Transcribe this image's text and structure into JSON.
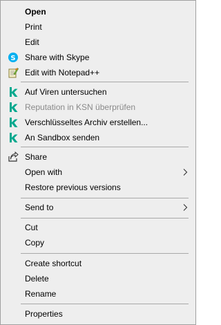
{
  "context_menu": {
    "items": [
      {
        "label": "Open",
        "icon": null
      },
      {
        "label": "Print",
        "icon": null
      },
      {
        "label": "Edit",
        "icon": null
      },
      {
        "label": "Share with Skype",
        "icon": "skype-icon"
      },
      {
        "label": "Edit with Notepad++",
        "icon": "notepad-plus-plus-icon"
      },
      {
        "label": "Auf Viren untersuchen",
        "icon": "kaspersky-icon"
      },
      {
        "label": "Reputation in KSN überprüfen",
        "icon": "kaspersky-icon",
        "disabled": true
      },
      {
        "label": "Verschlüsseltes Archiv erstellen...",
        "icon": "kaspersky-icon"
      },
      {
        "label": "An Sandbox senden",
        "icon": "kaspersky-icon"
      },
      {
        "label": "Share",
        "icon": "share-icon"
      },
      {
        "label": "Open with",
        "icon": null,
        "submenu": true
      },
      {
        "label": "Restore previous versions",
        "icon": null
      },
      {
        "label": "Send to",
        "icon": null,
        "submenu": true
      },
      {
        "label": "Cut",
        "icon": null
      },
      {
        "label": "Copy",
        "icon": null
      },
      {
        "label": "Create shortcut",
        "icon": null
      },
      {
        "label": "Delete",
        "icon": null
      },
      {
        "label": "Rename",
        "icon": null
      },
      {
        "label": "Properties",
        "icon": null
      }
    ]
  },
  "colors": {
    "menu_background": "#eeeeee",
    "menu_border": "#a0a0a0",
    "separator": "#a8a8a8",
    "disabled_text": "#8a8a8a",
    "skype_blue": "#00aff0",
    "kaspersky_green": "#00a88e"
  }
}
